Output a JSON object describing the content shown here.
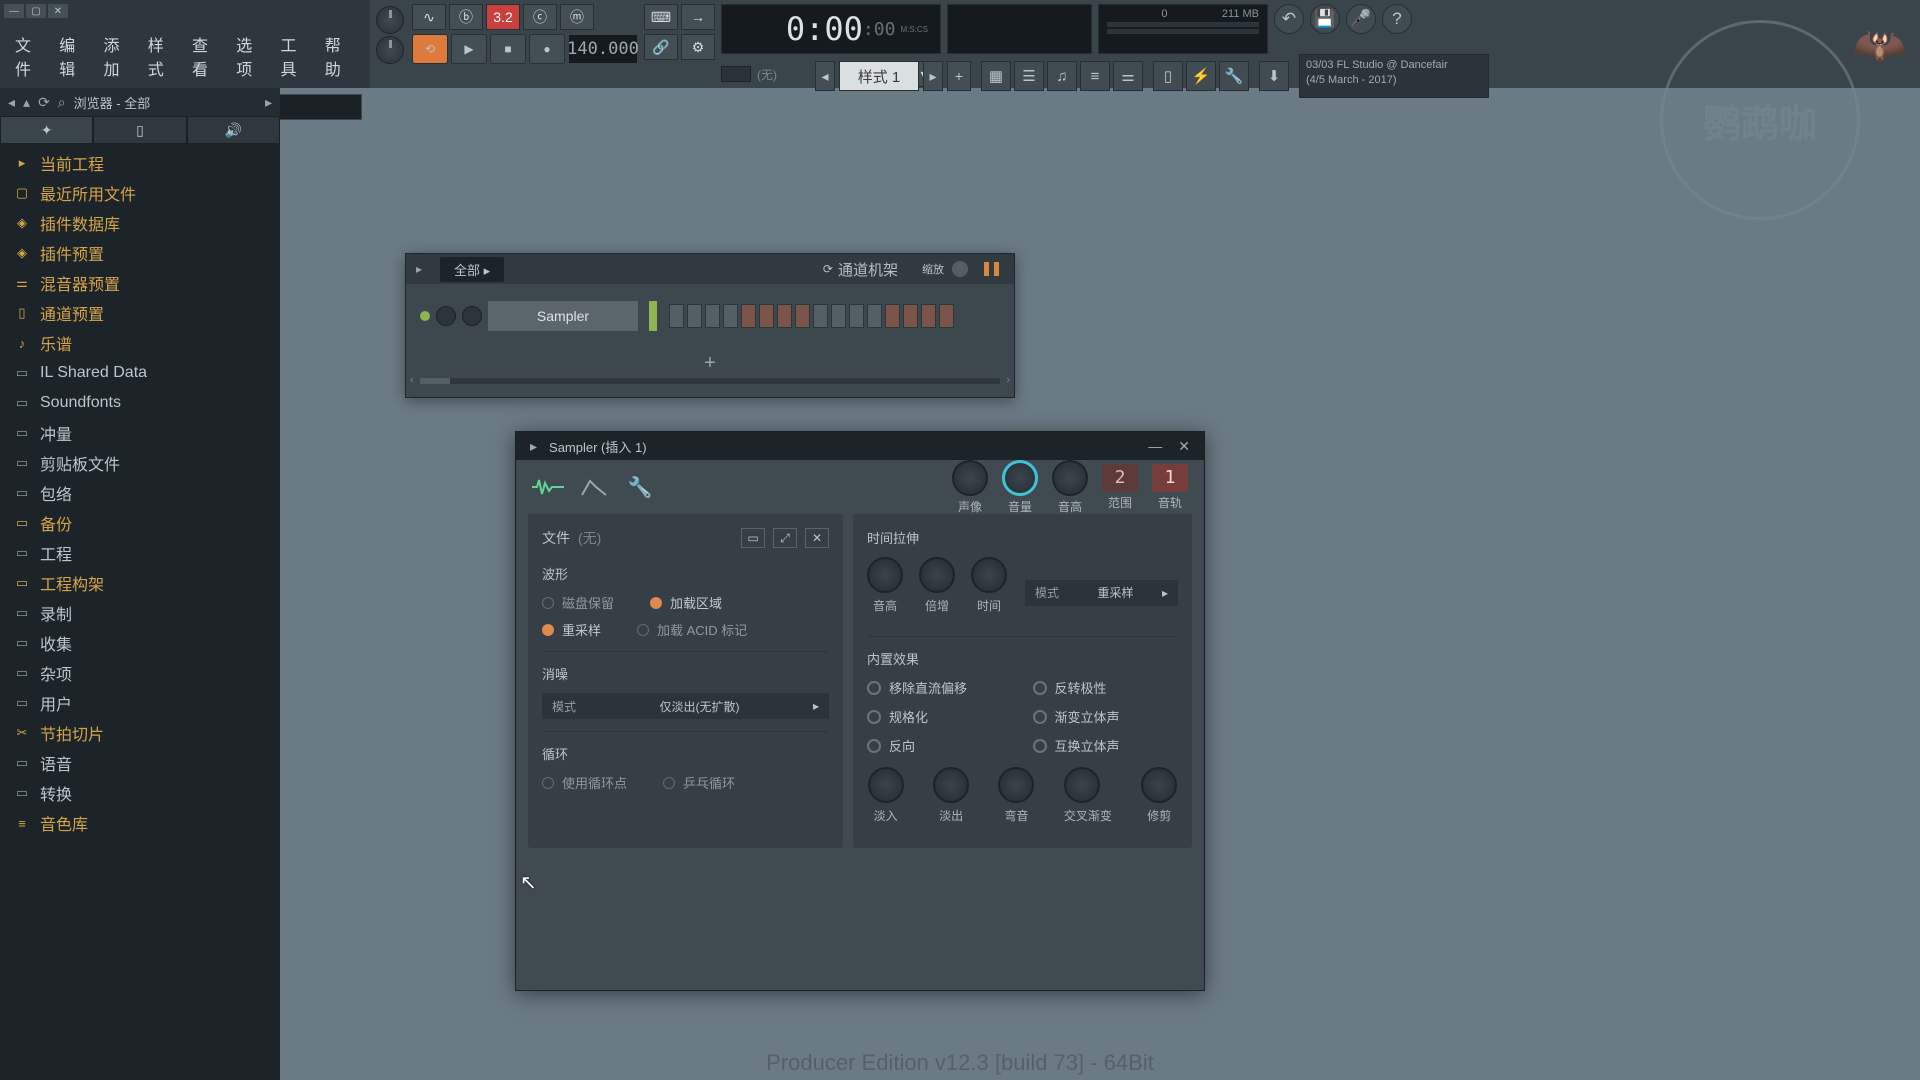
{
  "menu": {
    "file": "文件",
    "edit": "编辑",
    "add": "添加",
    "style": "样式",
    "view": "查看",
    "options": "选项",
    "tools": "工具",
    "help": "帮助"
  },
  "transport": {
    "tempo": "140.000",
    "time_big": "0:00",
    "time_small": ":00",
    "time_lbl": "M:S:CS",
    "cpu": "0",
    "mem": "211 MB"
  },
  "secondrow": {
    "none": "(无)"
  },
  "pattern": {
    "label": "样式 1"
  },
  "news": {
    "line1": "03/03  FL Studio @ Dancefair",
    "line2": "(4/5 March - 2017)"
  },
  "browser": {
    "hdr": "浏览器 - 全部",
    "items": [
      {
        "label": "当前工程",
        "imp": true,
        "icon": "▸"
      },
      {
        "label": "最近所用文件",
        "imp": true,
        "icon": "▢"
      },
      {
        "label": "插件数据库",
        "imp": true,
        "icon": "◈"
      },
      {
        "label": "插件预置",
        "imp": true,
        "icon": "◈"
      },
      {
        "label": "混音器预置",
        "imp": true,
        "icon": "⚌"
      },
      {
        "label": "通道预置",
        "imp": true,
        "icon": "▯"
      },
      {
        "label": "乐谱",
        "imp": true,
        "icon": "♪"
      },
      {
        "label": "IL Shared Data",
        "imp": false,
        "icon": "▭"
      },
      {
        "label": "Soundfonts",
        "imp": false,
        "icon": "▭"
      },
      {
        "label": "冲量",
        "imp": false,
        "icon": "▭"
      },
      {
        "label": "剪贴板文件",
        "imp": false,
        "icon": "▭"
      },
      {
        "label": "包络",
        "imp": false,
        "icon": "▭"
      },
      {
        "label": "备份",
        "imp": true,
        "icon": "▭"
      },
      {
        "label": "工程",
        "imp": false,
        "icon": "▭"
      },
      {
        "label": "工程构架",
        "imp": true,
        "icon": "▭"
      },
      {
        "label": "录制",
        "imp": false,
        "icon": "▭"
      },
      {
        "label": "收集",
        "imp": false,
        "icon": "▭"
      },
      {
        "label": "杂项",
        "imp": false,
        "icon": "▭"
      },
      {
        "label": "用户",
        "imp": false,
        "icon": "▭"
      },
      {
        "label": "节拍切片",
        "imp": true,
        "icon": "✂"
      },
      {
        "label": "语音",
        "imp": false,
        "icon": "▭"
      },
      {
        "label": "转换",
        "imp": false,
        "icon": "▭"
      },
      {
        "label": "音色库",
        "imp": true,
        "icon": "≡"
      }
    ]
  },
  "chrack": {
    "all": "全部",
    "title": "通道机架",
    "zoom": "缩放",
    "ch": "Sampler"
  },
  "sampler": {
    "title": "Sampler (插入 1)",
    "knob1": "声像",
    "knob2": "音量",
    "knob3": "音高",
    "knob4": "范围",
    "knob5": "音轨",
    "num1": "2",
    "num2": "1",
    "file": "文件",
    "file_none": "(无)",
    "waveform": "波形",
    "threading": "磁盘保留",
    "load_regions": "加载区域",
    "resample": "重采样",
    "load_acid": "加载 ACID 标记",
    "noise": "消噪",
    "mode": "模式",
    "fade_mode": "仅淡出(无扩散)",
    "loop": "循环",
    "use_loop": "使用循环点",
    "pingpong": "乒乓循环",
    "stretch": "时间拉伸",
    "pitch": "音高",
    "mul": "倍增",
    "time": "时间",
    "stretch_mode": "重采样",
    "builtin": "内置效果",
    "remove_dc": "移除直流偏移",
    "rev_polarity": "反转极性",
    "normalize": "规格化",
    "fade_stereo": "渐变立体声",
    "reverse": "反向",
    "swap_stereo": "互换立体声",
    "fadein": "淡入",
    "fadeout": "淡出",
    "pogo": "弯音",
    "crossfade": "交叉渐变",
    "trim": "修剪"
  },
  "footer": "Producer Edition v12.3 [build 73] - 64Bit",
  "logo": "鹦鹉咖"
}
